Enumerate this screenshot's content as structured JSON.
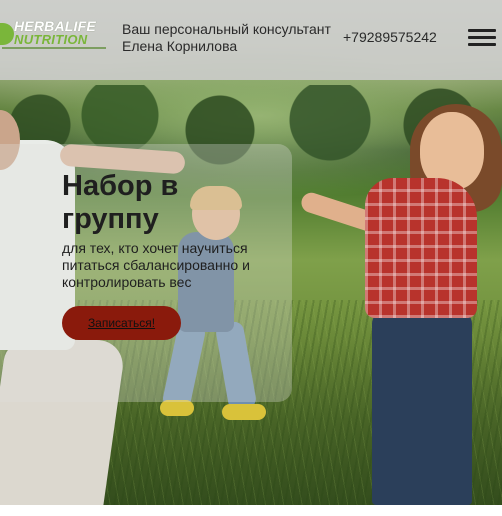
{
  "header": {
    "logo_line1": "HERBALIFE",
    "logo_line2": "NUTRITION",
    "consultant_line1": "Ваш персональный консультант",
    "consultant_line2": "Елена Корнилова",
    "phone": "+79289575242",
    "menu_icon": "hamburger-menu-icon"
  },
  "hero": {
    "title": "Набор в группу",
    "subtitle": "для тех, кто хочет научиться питаться сбалансированно и контролировать вес",
    "cta_label": "Записаться!"
  },
  "colors": {
    "header_bg": "#cdcdcd",
    "brand_green": "#7ab63a",
    "cta_bg": "#8a1a0c",
    "text": "#1f1f1f"
  }
}
